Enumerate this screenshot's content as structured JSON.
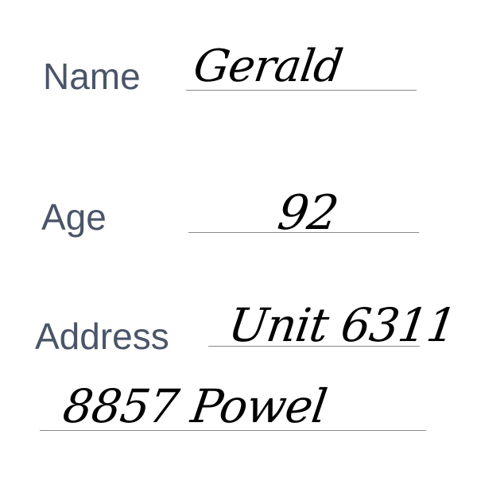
{
  "form": {
    "name": {
      "label": "Name",
      "value": "Gerald"
    },
    "age": {
      "label": "Age",
      "value": "92"
    },
    "address": {
      "label": "Address",
      "value_line1": "Unit 6311",
      "value_line2": "8857 Powel"
    }
  }
}
